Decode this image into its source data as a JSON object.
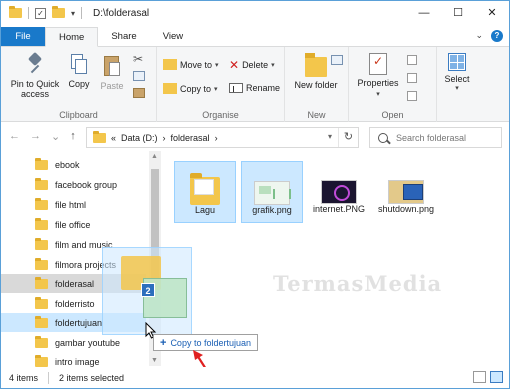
{
  "window": {
    "title": "D:\\folderasal",
    "controls": {
      "minimize": "—",
      "maximize": "☐",
      "close": "✕"
    }
  },
  "tabs": [
    {
      "label": "File"
    },
    {
      "label": "Home"
    },
    {
      "label": "Share"
    },
    {
      "label": "View"
    }
  ],
  "ribbon": {
    "clipboard": {
      "pin_label": "Pin to Quick access",
      "copy_label": "Copy",
      "paste_label": "Paste",
      "group_label": "Clipboard"
    },
    "organise": {
      "move_to": "Move to",
      "copy_to": "Copy to",
      "delete": "Delete",
      "rename": "Rename",
      "group_label": "Organise"
    },
    "new": {
      "new_folder": "New folder",
      "group_label": "New"
    },
    "open": {
      "properties": "Properties",
      "group_label": "Open"
    },
    "select": {
      "select_label": "Select"
    }
  },
  "address": {
    "prefix": "«",
    "crumbs": [
      "Data (D:)",
      "folderasal"
    ],
    "separator": "›",
    "search_placeholder": "Search folderasal"
  },
  "nav_items": [
    {
      "label": "ebook"
    },
    {
      "label": "facebook group"
    },
    {
      "label": "file html"
    },
    {
      "label": "file office"
    },
    {
      "label": "film and music"
    },
    {
      "label": "filmora projects"
    },
    {
      "label": "folderasal"
    },
    {
      "label": "folderristo"
    },
    {
      "label": "foldertujuan"
    },
    {
      "label": "gambar youtube"
    },
    {
      "label": "intro image"
    }
  ],
  "files": [
    {
      "name": "Lagu",
      "icon": "folder-icon"
    },
    {
      "name": "grafik.png",
      "icon": "image-icon"
    },
    {
      "name": "internet.PNG",
      "icon": "image-icon"
    },
    {
      "name": "shutdown.png",
      "icon": "image-icon"
    }
  ],
  "drag": {
    "badge_count": "2",
    "tooltip": "Copy to foldertujuan",
    "tooltip_symbol": "+"
  },
  "watermark": "TermasMedia",
  "status": {
    "items": "4 items",
    "selected": "2 items selected"
  },
  "colors": {
    "accent": "#1979ca",
    "selection": "#cce8ff",
    "folder": "#f3c64b",
    "arrow": "#e02020"
  }
}
